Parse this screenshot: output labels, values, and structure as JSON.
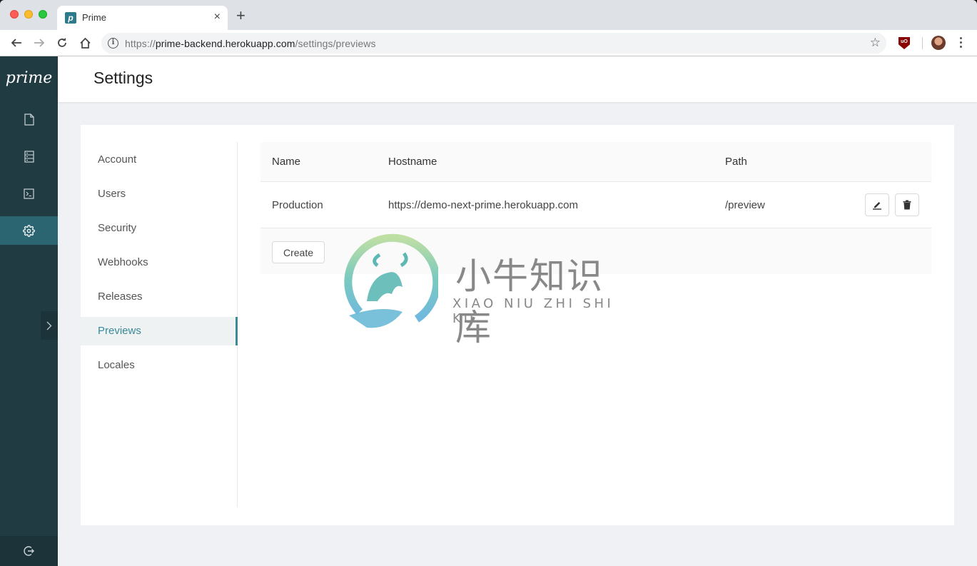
{
  "browser": {
    "tab_title": "Prime",
    "tab_favicon_letter": "p",
    "tab_close": "×",
    "new_tab": "+",
    "url_scheme": "https://",
    "url_host": "prime-backend.herokuapp.com",
    "url_path": "/settings/previews",
    "extension_label": "uO"
  },
  "sidebar": {
    "logo": "prime",
    "items": [
      {
        "name": "documents",
        "icon": "file-icon",
        "active": false
      },
      {
        "name": "schemas",
        "icon": "list-icon",
        "active": false
      },
      {
        "name": "playground",
        "icon": "terminal-icon",
        "active": false
      },
      {
        "name": "settings",
        "icon": "gear-icon",
        "active": true
      }
    ],
    "collapse_icon": "chevron-right-icon",
    "logout_icon": "logout-icon"
  },
  "header": {
    "title": "Settings"
  },
  "settings_nav": {
    "items": [
      {
        "label": "Account",
        "active": false
      },
      {
        "label": "Users",
        "active": false
      },
      {
        "label": "Security",
        "active": false
      },
      {
        "label": "Webhooks",
        "active": false
      },
      {
        "label": "Releases",
        "active": false
      },
      {
        "label": "Previews",
        "active": true
      },
      {
        "label": "Locales",
        "active": false
      }
    ],
    "accent_color": "#3a8a97"
  },
  "previews_table": {
    "columns": [
      "Name",
      "Hostname",
      "Path"
    ],
    "rows": [
      {
        "name": "Production",
        "hostname": "https://demo-next-prime.herokuapp.com",
        "path": "/preview"
      }
    ],
    "row_actions": [
      "edit-icon",
      "delete-icon"
    ],
    "create_label": "Create"
  },
  "watermark": {
    "title": "小牛知识库",
    "subtitle": "XIAO NIU ZHI SHI KU"
  }
}
